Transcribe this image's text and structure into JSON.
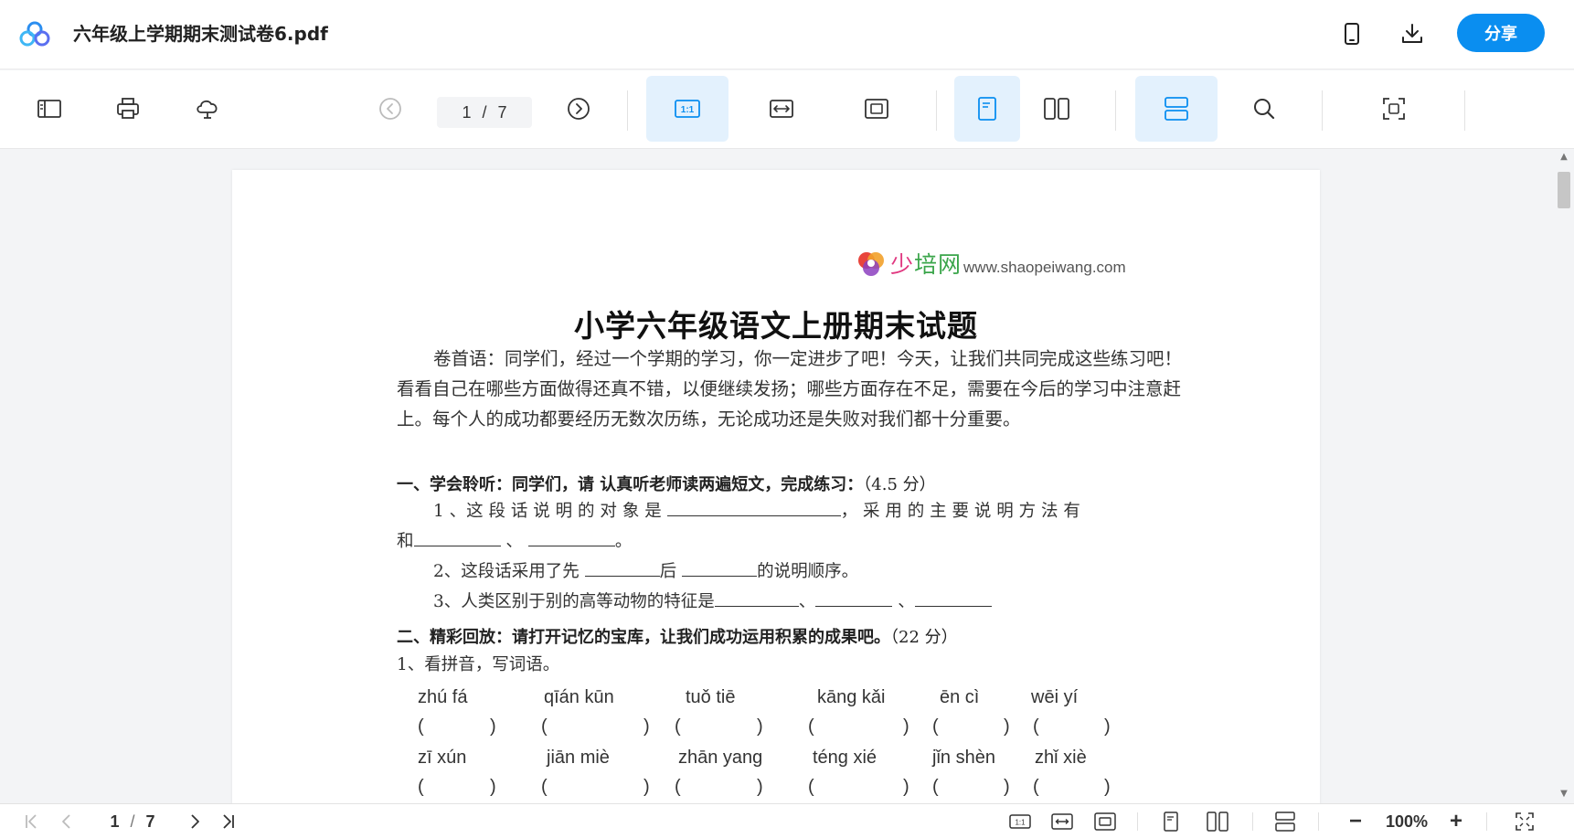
{
  "header": {
    "doc_title": "六年级上学期期末测试卷6.pdf",
    "share_label": "分享",
    "icons": [
      "app-logo-icon",
      "mobile-icon",
      "download-icon"
    ]
  },
  "toolbar": {
    "page_current": "1",
    "page_sep": "/",
    "page_total": "7",
    "actual_size_label": "1:1",
    "icons": [
      "sidebar-toggle-icon",
      "print-icon",
      "cloud-save-icon",
      "prev-page-icon",
      "next-page-icon",
      "actual-size-icon",
      "fit-width-icon",
      "fit-page-icon",
      "single-page-icon",
      "two-page-icon",
      "continuous-scroll-icon",
      "search-icon",
      "scan-icon"
    ],
    "active": [
      "actual-size",
      "single-page",
      "continuous-scroll"
    ]
  },
  "document": {
    "site_logo_text_a": "少",
    "site_logo_text_b": "培网",
    "site_url": "www.shaopeiwang.com",
    "title": "小学六年级语文上册期末试题",
    "intro": "卷首语：同学们，经过一个学期的学习，你一定进步了吧！今天，让我们共同完成这些练习吧！看看自己在哪些方面做得还真不错，以便继续发扬；哪些方面存在不足，需要在今后的学习中注意赶上。每个人的成功都要经历无数次历练，无论成功还是失败对我们都十分重要。",
    "section1_title": "一、学会聆听：同学们，请 认真听老师读两遍短文，完成练习：",
    "section1_score": "（4.5 分）",
    "q1_a": "1 、这 段 话 说 明 的 对 象 是",
    "q1_b": "， 采 用 的 主 要 说 明 方 法 有",
    "q1_c": "和",
    "q1_d": "、",
    "q1_e": "。",
    "q2_a": "2、这段话采用了先",
    "q2_b": "后",
    "q2_c": "的说明顺序。",
    "q3_a": "3、人类区别于别的高等动物的特征是",
    "q3_b": "、",
    "q3_c": "、",
    "section2_title": "二、精彩回放：请打开记忆的宝库，让我们成功运用积累的成果吧。",
    "section2_score": "（22 分）",
    "sub1": "1、看拼音，写词语。",
    "pinyin_row1": [
      "zhú  fá",
      "qīán  kūn",
      "tuǒ  tiē",
      "kāng  kǎi",
      "ēn  cì",
      "wēi  yí"
    ],
    "pinyin_row2": [
      "zī   xún",
      "jiān   miè",
      "zhān yang",
      "téng  xié",
      "jǐn  shèn",
      "zhǐ xiè"
    ],
    "paren_open": "(",
    "paren_close": ")"
  },
  "bottom": {
    "page_current": "1",
    "page_sep": "/",
    "page_total": "7",
    "zoom_out": "−",
    "zoom_level": "100%",
    "zoom_in": "+",
    "actual_size_label": "1:1",
    "icons": [
      "first-page-icon",
      "prev-page-icon",
      "next-page-icon",
      "last-page-icon",
      "actual-size-icon",
      "fit-width-icon",
      "fit-page-icon",
      "single-page-icon",
      "two-page-icon",
      "continuous-scroll-icon",
      "fullscreen-icon"
    ]
  },
  "colors": {
    "accent": "#0a8ef0",
    "active_bg": "#e3f1fd",
    "icon": "#333333",
    "disabled_icon": "#bbbbbb"
  }
}
